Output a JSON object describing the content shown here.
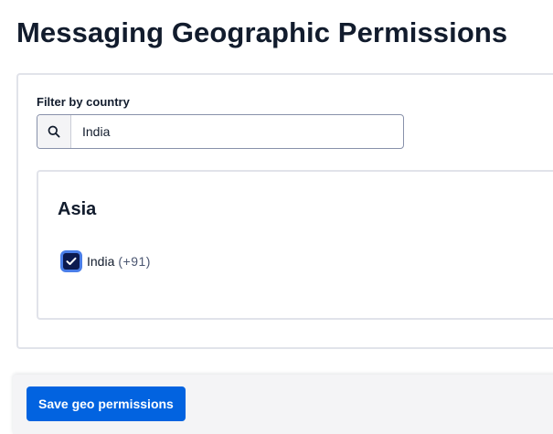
{
  "page": {
    "title": "Messaging Geographic Permissions"
  },
  "filter": {
    "label": "Filter by country",
    "value": "India",
    "search_icon": "search-icon"
  },
  "regions": [
    {
      "name": "Asia",
      "countries": [
        {
          "name": "India",
          "code": "(+91)",
          "checked": true
        }
      ]
    }
  ],
  "footer": {
    "save_label": "Save geo permissions"
  },
  "colors": {
    "primary_button": "#0263e0",
    "checkbox_fill": "#0c1a4f",
    "focus_ring": "#4a7ee8",
    "text": "#121c2d",
    "border": "#e1e3ea"
  }
}
